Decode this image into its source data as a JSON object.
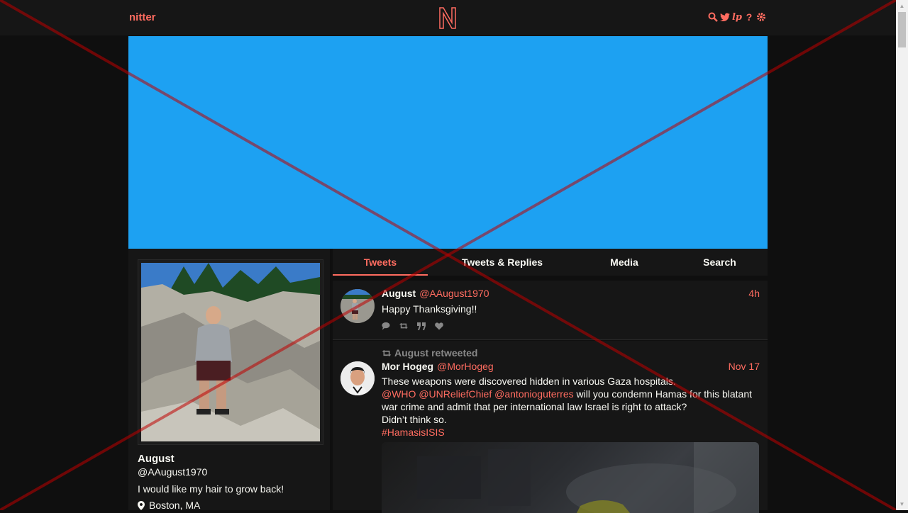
{
  "navbar": {
    "brand": "nitter",
    "logo_letter": "N",
    "icons": [
      "search-icon",
      "twitter-icon",
      "rss-icon",
      "help-icon",
      "settings-icon"
    ]
  },
  "banner": {
    "color": "#1da1f2"
  },
  "profile": {
    "fullname": "August",
    "username": "@AAugust1970",
    "bio": "I would like my hair to grow back!",
    "location": "Boston, MA"
  },
  "tabs": [
    {
      "label": "Tweets",
      "active": true
    },
    {
      "label": "Tweets & Replies",
      "active": false
    },
    {
      "label": "Media",
      "active": false
    },
    {
      "label": "Search",
      "active": false
    }
  ],
  "tweets": [
    {
      "name": "August",
      "handle": "@AAugust1970",
      "date": "4h",
      "text": "Happy Thanksgiving!!"
    },
    {
      "retweet_header": "August retweeted",
      "name": "Mor Hogeg",
      "handle": "@MorHogeg",
      "date": "Nov 17",
      "line1": "These weapons were discovered hidden in various Gaza hospitals.",
      "mention1": "@WHO",
      "mention2": "@UNReliefChief",
      "mention3": "@antonioguterres",
      "line2": " will you condemn Hamas for this blatant war crime and admit that per international law Israel is right to attack?",
      "line3": "Didn’t think so.",
      "hashtag": "#HamasisISIS"
    }
  ],
  "colors": {
    "accent": "#ff6c60",
    "background": "#0f0f0f",
    "panel": "#161616"
  }
}
